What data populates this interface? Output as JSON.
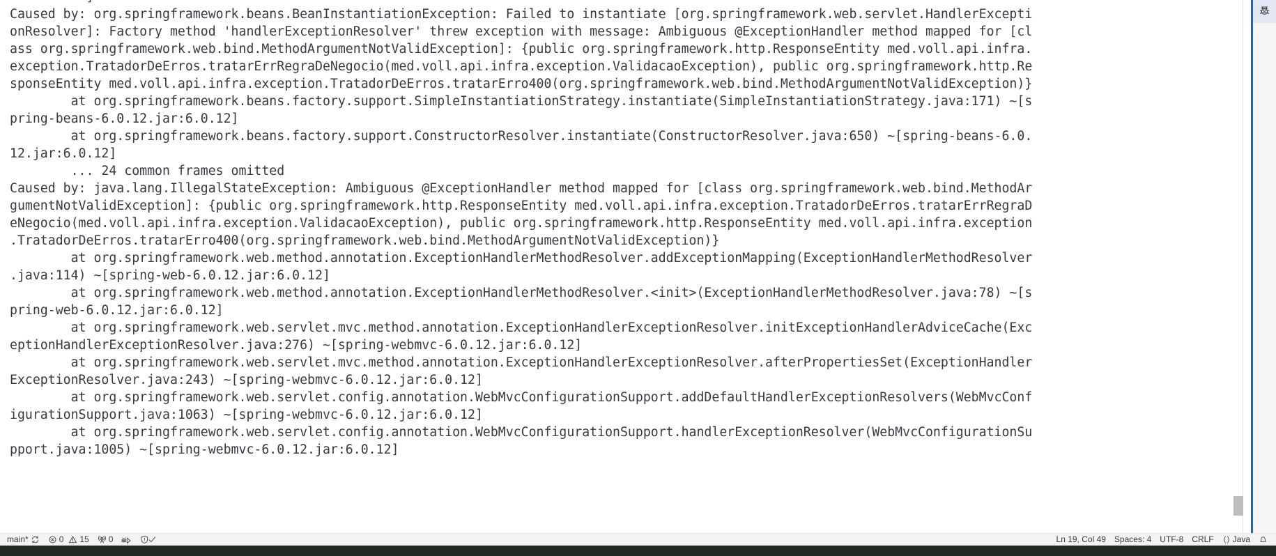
{
  "editor": {
    "language": "Java",
    "word_wrap": true,
    "lines": [
      "          ]",
      "Caused by: org.springframework.beans.BeanInstantiationException: Failed to instantiate [org.springframework.web.servlet.HandlerExcepti",
      "onResolver]: Factory method 'handlerExceptionResolver' threw exception with message: Ambiguous @ExceptionHandler method mapped for [cl",
      "ass org.springframework.web.bind.MethodArgumentNotValidException]: {public org.springframework.http.ResponseEntity med.voll.api.infra.",
      "exception.TratadorDeErros.tratarErrRegraDeNegocio(med.voll.api.infra.exception.ValidacaoException), public org.springframework.http.Re",
      "sponseEntity med.voll.api.infra.exception.TratadorDeErros.tratarErro400(org.springframework.web.bind.MethodArgumentNotValidException)}",
      "        at org.springframework.beans.factory.support.SimpleInstantiationStrategy.instantiate(SimpleInstantiationStrategy.java:171) ~[s",
      "pring-beans-6.0.12.jar:6.0.12]",
      "        at org.springframework.beans.factory.support.ConstructorResolver.instantiate(ConstructorResolver.java:650) ~[spring-beans-6.0.",
      "12.jar:6.0.12]",
      "        ... 24 common frames omitted",
      "Caused by: java.lang.IllegalStateException: Ambiguous @ExceptionHandler method mapped for [class org.springframework.web.bind.MethodAr",
      "gumentNotValidException]: {public org.springframework.http.ResponseEntity med.voll.api.infra.exception.TratadorDeErros.tratarErrRegraD",
      "eNegocio(med.voll.api.infra.exception.ValidacaoException), public org.springframework.http.ResponseEntity med.voll.api.infra.exception",
      ".TratadorDeErros.tratarErro400(org.springframework.web.bind.MethodArgumentNotValidException)}",
      "        at org.springframework.web.method.annotation.ExceptionHandlerMethodResolver.addExceptionMapping(ExceptionHandlerMethodResolver",
      ".java:114) ~[spring-web-6.0.12.jar:6.0.12]",
      "        at org.springframework.web.method.annotation.ExceptionHandlerMethodResolver.<init>(ExceptionHandlerMethodResolver.java:78) ~[s",
      "pring-web-6.0.12.jar:6.0.12]",
      "        at org.springframework.web.servlet.mvc.method.annotation.ExceptionHandlerExceptionResolver.initExceptionHandlerAdviceCache(Exc",
      "eptionHandlerExceptionResolver.java:276) ~[spring-webmvc-6.0.12.jar:6.0.12]",
      "        at org.springframework.web.servlet.mvc.method.annotation.ExceptionHandlerExceptionResolver.afterPropertiesSet(ExceptionHandler",
      "ExceptionResolver.java:243) ~[spring-webmvc-6.0.12.jar:6.0.12]",
      "        at org.springframework.web.servlet.config.annotation.WebMvcConfigurationSupport.addDefaultHandlerExceptionResolvers(WebMvcConf",
      "igurationSupport.java:1063) ~[spring-webmvc-6.0.12.jar:6.0.12]",
      "        at org.springframework.web.servlet.config.annotation.WebMvcConfigurationSupport.handlerExceptionResolver(WebMvcConfigurationSu",
      "pport.java:1005) ~[spring-webmvc-6.0.12.jar:6.0.12]"
    ]
  },
  "right_panel": {
    "tab_icon": "debug-disconnect-icon",
    "accent_color": "#1668c1"
  },
  "status_bar": {
    "left": {
      "branch": "main*",
      "sync_icon": "sync-icon",
      "errors_icon": "error-circle-icon",
      "errors": "0",
      "warnings_icon": "warning-triangle-icon",
      "warnings": "15",
      "ports_icon": "radio-tower-icon",
      "ports": "0",
      "debug_icon": "debug-alt-icon",
      "shield_icon": "shield-check-icon"
    },
    "right": {
      "cursor_position": "Ln 19, Col 49",
      "indentation": "Spaces: 4",
      "encoding": "UTF-8",
      "eol": "CRLF",
      "language_icon": "braces-icon",
      "language": "Java",
      "bell_icon": "bell-icon"
    }
  },
  "colors": {
    "editor_background": "#ffffff",
    "editor_foreground": "#383a42",
    "status_background": "#f3f3f3",
    "status_foreground": "#3b3b3b",
    "scrollbar_thumb": "#bdbdbd",
    "bottom_strip": "#1e2a22"
  }
}
